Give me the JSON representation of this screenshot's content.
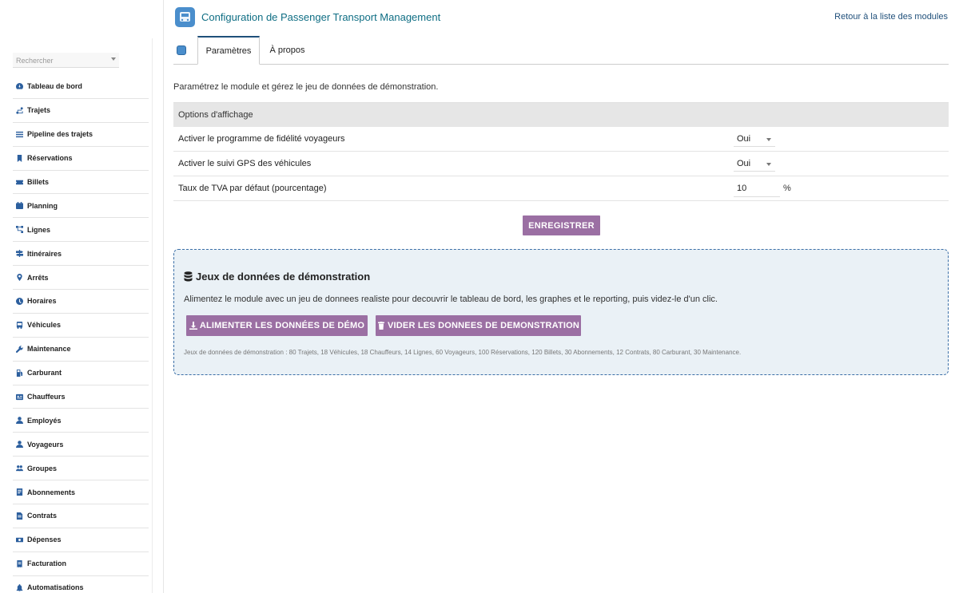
{
  "sidebar": {
    "search_placeholder": "Rechercher",
    "items": [
      {
        "label": "Tableau de bord",
        "icon": "dashboard-icon"
      },
      {
        "label": "Trajets",
        "icon": "route-icon"
      },
      {
        "label": "Pipeline des trajets",
        "icon": "list-icon"
      },
      {
        "label": "Réservations",
        "icon": "bookmark-icon"
      },
      {
        "label": "Billets",
        "icon": "ticket-icon"
      },
      {
        "label": "Planning",
        "icon": "calendar-icon"
      },
      {
        "label": "Lignes",
        "icon": "network-icon"
      },
      {
        "label": "Itinéraires",
        "icon": "signpost-icon"
      },
      {
        "label": "Arrêts",
        "icon": "map-pin-icon"
      },
      {
        "label": "Horaires",
        "icon": "clock-icon"
      },
      {
        "label": "Véhicules",
        "icon": "bus-icon"
      },
      {
        "label": "Maintenance",
        "icon": "wrench-icon"
      },
      {
        "label": "Carburant",
        "icon": "fuel-icon"
      },
      {
        "label": "Chauffeurs",
        "icon": "id-card-icon"
      },
      {
        "label": "Employés",
        "icon": "user-icon"
      },
      {
        "label": "Voyageurs",
        "icon": "user-icon"
      },
      {
        "label": "Groupes",
        "icon": "users-icon"
      },
      {
        "label": "Abonnements",
        "icon": "document-icon"
      },
      {
        "label": "Contrats",
        "icon": "file-icon"
      },
      {
        "label": "Dépenses",
        "icon": "money-icon"
      },
      {
        "label": "Facturation",
        "icon": "invoice-icon"
      },
      {
        "label": "Automatisations",
        "icon": "bell-icon"
      }
    ]
  },
  "header": {
    "title": "Configuration de Passenger Transport Management",
    "back_link": "Retour à la liste des modules"
  },
  "tabs": {
    "active": "Paramètres",
    "other": "À propos"
  },
  "intro": "Paramétrez le module et gérez le jeu de données de démonstration.",
  "options": {
    "heading": "Options d'affichage",
    "rows": [
      {
        "label": "Activer le programme de fidélité voyageurs",
        "value": "Oui"
      },
      {
        "label": "Activer le suivi GPS des véhicules",
        "value": "Oui"
      },
      {
        "label": "Taux de TVA par défaut (pourcentage)",
        "value": "10",
        "unit": "%"
      }
    ]
  },
  "save_label": "ENREGISTRER",
  "demo": {
    "title": "Jeux de données de démonstration",
    "description": "Alimentez le module avec un jeu de donnees realiste pour decouvrir le tableau de bord, les graphes et le reporting, puis videz-le d'un clic.",
    "load_label": "ALIMENTER LES DONNÉES DE DÉMO",
    "clear_label": "VIDER LES DONNEES DE DEMONSTRATION",
    "info": "Jeux de données de démonstration : 80 Trajets, 18 Véhicules, 18 Chauffeurs, 14 Lignes, 60 Voyageurs, 100 Réservations, 120 Billets, 30 Abonnements, 12 Contrats, 80 Carburant, 30 Maintenance."
  },
  "colors": {
    "accent": "#9b6fa3",
    "title_teal": "#0f6e84",
    "icon_blue": "#2c5f9e",
    "demo_bg": "#eaf1f6"
  }
}
